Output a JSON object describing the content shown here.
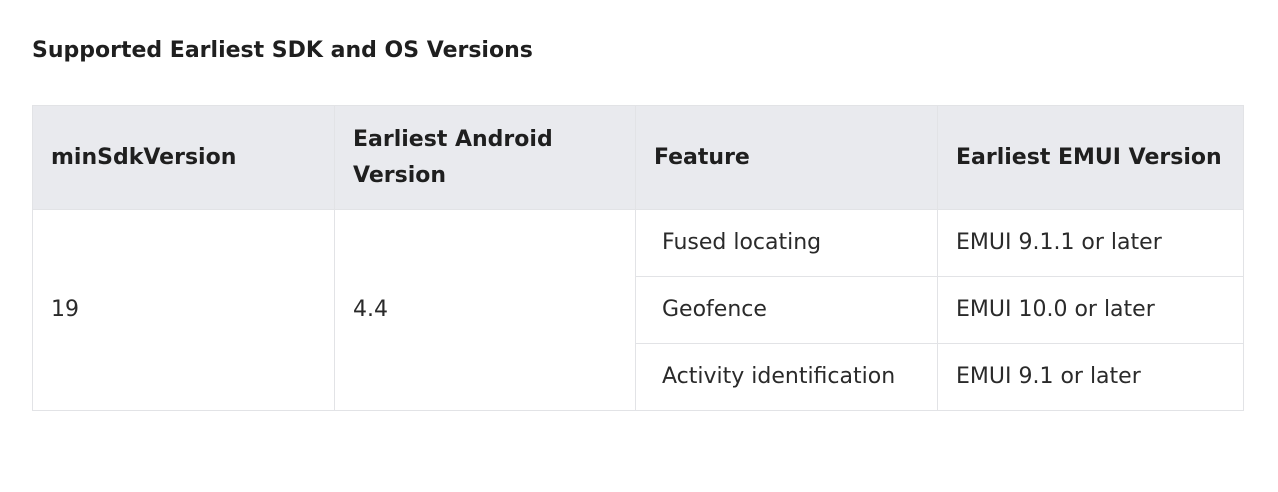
{
  "section": {
    "title": "Supported Earliest SDK and OS Versions"
  },
  "table": {
    "headers": [
      "minSdkVersion",
      "Earliest Android Version",
      "Feature",
      "Earliest EMUI Version"
    ],
    "min_sdk_version": "19",
    "earliest_android_version": "4.4",
    "features": [
      {
        "feature": "Fused locating",
        "emui": "EMUI 9.1.1 or later"
      },
      {
        "feature": "Geofence",
        "emui": "EMUI 10.0 or later"
      },
      {
        "feature": "Activity identification",
        "emui": "EMUI 9.1 or later"
      }
    ]
  }
}
